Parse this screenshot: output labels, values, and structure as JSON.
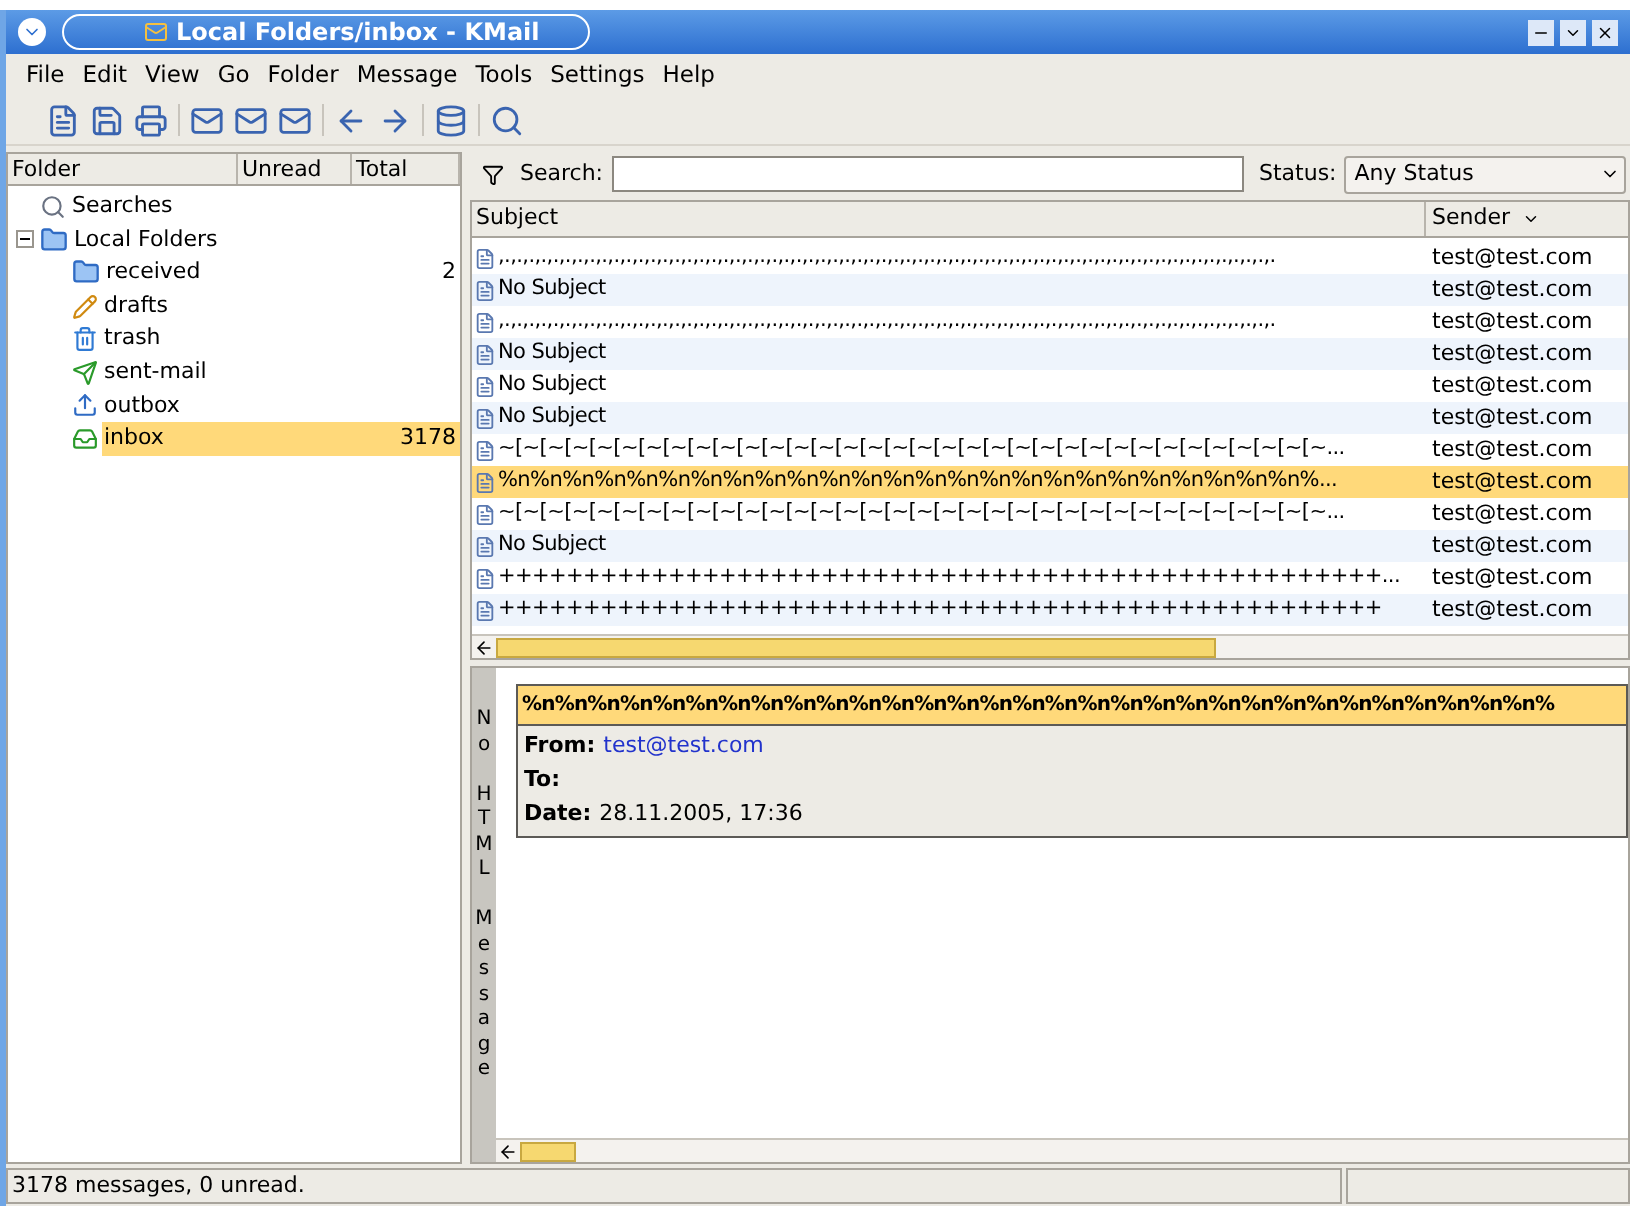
{
  "window": {
    "title": "Local Folders/inbox - KMail"
  },
  "menu": [
    "File",
    "Edit",
    "View",
    "Go",
    "Folder",
    "Message",
    "Tools",
    "Settings",
    "Help"
  ],
  "folder_pane": {
    "columns": [
      "Folder",
      "Unread",
      "Total"
    ],
    "tree": [
      {
        "name": "Searches",
        "kind": "search",
        "selected": false
      },
      {
        "name": "Local Folders",
        "kind": "folder",
        "selected": false,
        "expanded": true,
        "children": [
          {
            "name": "received",
            "kind": "folder",
            "selected": false,
            "total": "2"
          },
          {
            "name": "drafts",
            "kind": "drafts",
            "selected": false
          },
          {
            "name": "trash",
            "kind": "trash",
            "selected": false
          },
          {
            "name": "sent-mail",
            "kind": "sent",
            "selected": false
          },
          {
            "name": "outbox",
            "kind": "outbox",
            "selected": false
          },
          {
            "name": "inbox",
            "kind": "inbox",
            "selected": true,
            "total": "3178"
          }
        ]
      }
    ]
  },
  "search_bar": {
    "label": "Search:",
    "status_label": "Status:",
    "status_value": "Any Status"
  },
  "message_list": {
    "columns": [
      "Subject",
      "Sender"
    ],
    "rows": [
      {
        "subject": ",.,.,.,.,.,.,.,.,.,.,.,.,.,.,.,.,.,.,.,.,.,.,.,.,.,.,.,.,.,.,.,.,.,.,.,.,.,.,.,.,.,.,.,.,.,.,.,.,.,.,.,.,.,.,.,.,.,.,.,.,.,.,.,.",
        "sender": "test@test.com",
        "selected": false
      },
      {
        "subject": "No Subject",
        "sender": "test@test.com",
        "selected": false
      },
      {
        "subject": ",.,.,.,.,.,.,.,.,.,.,.,.,.,.,.,.,.,.,.,.,.,.,.,.,.,.,.,.,.,.,.,.,.,.,.,.,.,.,.,.,.,.,.,.,.,.,.,.,.,.,.,.,.,.,.,.,.,.,.,.,.,.,.,.",
        "sender": "test@test.com",
        "selected": false
      },
      {
        "subject": "No Subject",
        "sender": "test@test.com",
        "selected": false
      },
      {
        "subject": "No Subject",
        "sender": "test@test.com",
        "selected": false
      },
      {
        "subject": "No Subject",
        "sender": "test@test.com",
        "selected": false
      },
      {
        "subject": "~[~[~[~[~[~[~[~[~[~[~[~[~[~[~[~[~[~[~[~[~[~[~[~[~[~[~[~[~[~[~[~[~[~...",
        "sender": "test@test.com",
        "selected": false
      },
      {
        "subject": "%n%n%n%n%n%n%n%n%n%n%n%n%n%n%n%n%n%n%n%n%n%n%n%n%n%...",
        "sender": "test@test.com",
        "selected": true
      },
      {
        "subject": "~[~[~[~[~[~[~[~[~[~[~[~[~[~[~[~[~[~[~[~[~[~[~[~[~[~[~[~[~[~[~[~[~[~...",
        "sender": "test@test.com",
        "selected": false
      },
      {
        "subject": "No Subject",
        "sender": "test@test.com",
        "selected": false
      },
      {
        "subject": "++++++++++++++++++++++++++++++++++++++++++++++++++++...",
        "sender": "test@test.com",
        "selected": false
      },
      {
        "subject": "++++++++++++++++++++++++++++++++++++++++++++++++++++",
        "sender": "test@test.com",
        "selected": false
      }
    ]
  },
  "preview": {
    "side_label": "No HTML Message",
    "subject": "%n%n%n%n%n%n%n%n%n%n%n%n%n%n%n%n%n%n%n%n%n%n%n%n%n%n%n%n%n%n%n%",
    "fields": [
      {
        "label": "From:",
        "value": "test@test.com",
        "kind": "link"
      },
      {
        "label": "To:"
      },
      {
        "label": "Date:",
        "value": "28.11.2005, 17:36",
        "kind": "text"
      }
    ]
  },
  "status_bar": {
    "text": "3178 messages, 0 unread."
  }
}
